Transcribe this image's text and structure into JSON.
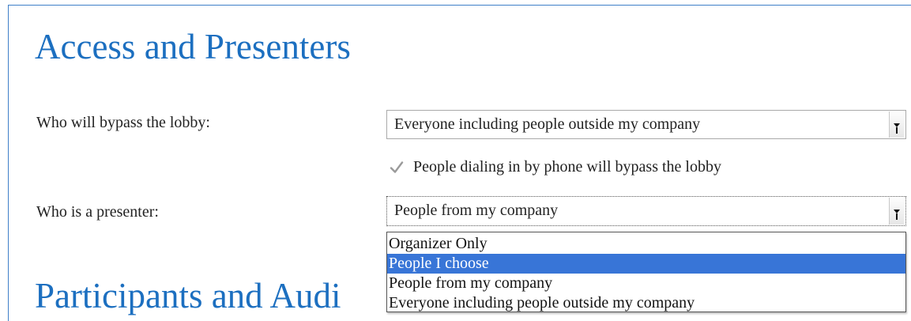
{
  "sections": {
    "access_title": "Access and Presenters",
    "participants_title": "Participants and Audi"
  },
  "bypass": {
    "label": "Who will bypass the lobby:",
    "selected_value": "Everyone including people outside my company"
  },
  "phone_bypass": {
    "label": "People dialing in by phone will bypass the lobby",
    "checked": true
  },
  "presenter": {
    "label": "Who is a presenter:",
    "selected_value": "People from my company",
    "options": [
      "Organizer Only",
      "People I choose",
      "People from my company",
      "Everyone including people outside my company"
    ],
    "highlighted_option": "People I choose"
  },
  "colors": {
    "heading": "#1c6fc0",
    "highlight": "#3875d7",
    "frame_border": "#3f7fc8"
  },
  "icons": {
    "checkbox": "checkmark-icon",
    "select_arrow": "dropdown-arrow-icon"
  }
}
